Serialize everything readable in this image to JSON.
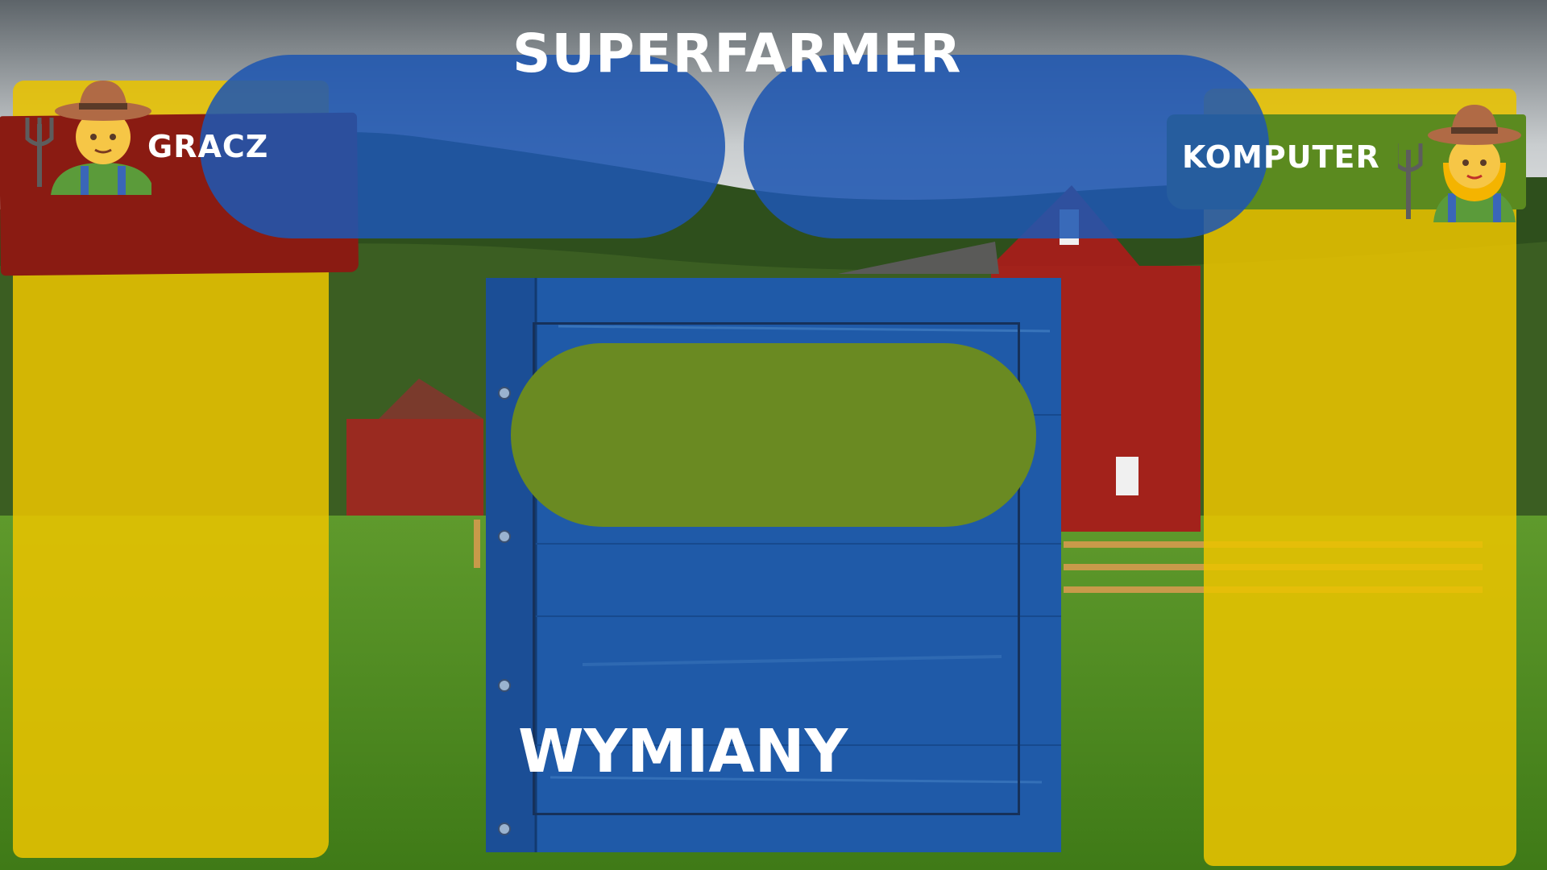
{
  "game": {
    "title": "SUPERFARMER"
  },
  "players": {
    "left": {
      "name": "GRACZ",
      "avatar": "male-farmer-icon",
      "banner_color": "#8a1b12"
    },
    "right": {
      "name": "KOMPUTER",
      "avatar": "female-farmer-icon",
      "banner_color": "#5b8a1f"
    }
  },
  "exchange": {
    "title": "WYMIANY"
  },
  "colors": {
    "panel_yellow": "#e8c300",
    "pill_blue": "#1f56b0",
    "pill_green": "#6a8a22",
    "board_blue": "#1f5aa8"
  }
}
